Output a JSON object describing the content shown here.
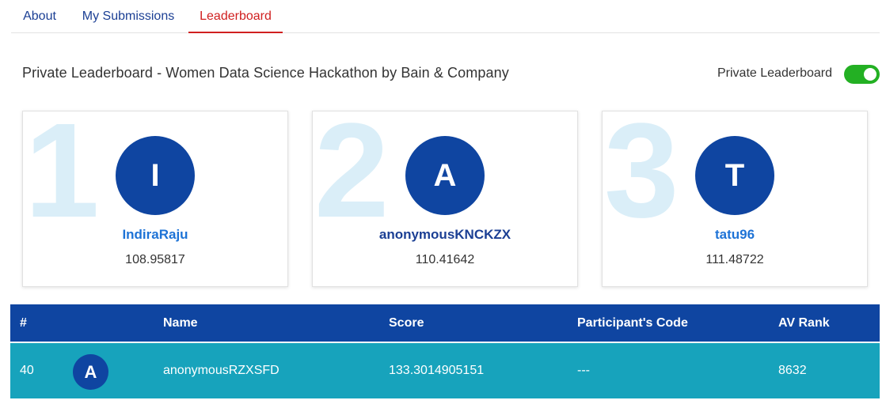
{
  "tabs": [
    {
      "label": "About"
    },
    {
      "label": "My Submissions"
    },
    {
      "label": "Leaderboard",
      "active": true
    }
  ],
  "page_title": "Private Leaderboard - Women Data Science Hackathon by Bain & Company",
  "toggle": {
    "label": "Private Leaderboard",
    "on": true
  },
  "podium": [
    {
      "rank": "1",
      "initial": "I",
      "name": "IndiraRaju",
      "score": "108.95817"
    },
    {
      "rank": "2",
      "initial": "A",
      "name": "anonymousKNCKZX",
      "score": "110.41642"
    },
    {
      "rank": "3",
      "initial": "T",
      "name": "tatu96",
      "score": "111.48722"
    }
  ],
  "table": {
    "headers": {
      "num": "#",
      "name": "Name",
      "score": "Score",
      "code": "Participant's Code",
      "av_rank": "AV Rank"
    },
    "rows": [
      {
        "num": "40",
        "initial": "A",
        "name": "anonymousRZXSFD",
        "score": "133.3014905151",
        "code": "---",
        "av_rank": "8632"
      }
    ]
  },
  "colors": {
    "primary": "#0f45a1",
    "active_tab": "#d02020",
    "row_highlight": "#17a3bc",
    "toggle_on": "#23b023"
  }
}
